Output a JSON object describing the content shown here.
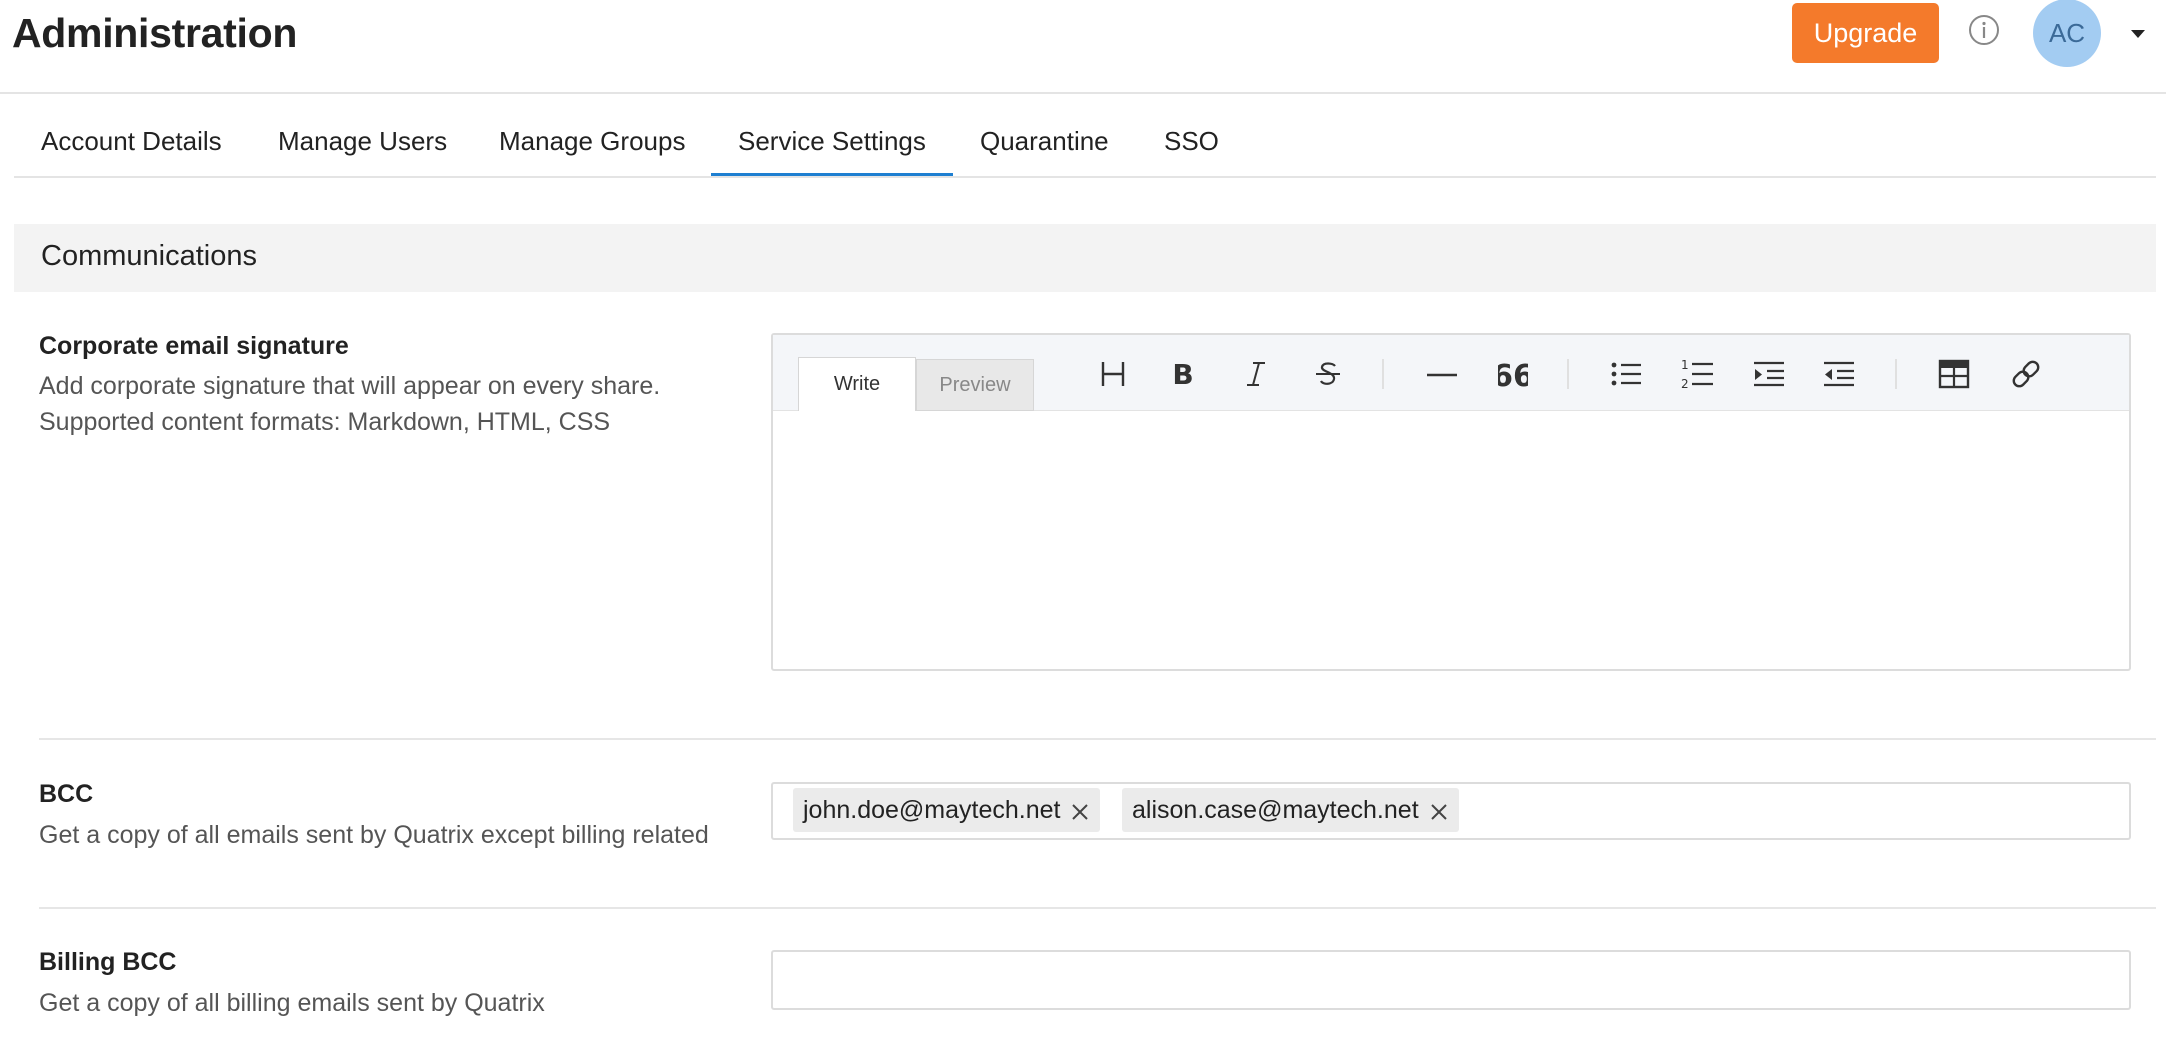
{
  "header": {
    "title": "Administration",
    "upgrade_label": "Upgrade",
    "avatar_initials": "AC",
    "info_icon": "info-icon",
    "caret_icon": "caret-down-icon",
    "accent_color": "#f47a2b"
  },
  "tabs": {
    "items": [
      {
        "label": "Account Details"
      },
      {
        "label": "Manage Users"
      },
      {
        "label": "Manage Groups"
      },
      {
        "label": "Service Settings"
      },
      {
        "label": "Quarantine"
      },
      {
        "label": "SSO"
      }
    ],
    "active": "Service Settings",
    "active_color": "#1e7fd1"
  },
  "section": {
    "title": "Communications"
  },
  "signature": {
    "label": "Corporate email signature",
    "desc_line1": "Add corporate signature that will appear on every share.",
    "desc_line2": "Supported content formats: Markdown, HTML, CSS",
    "editor_tabs": {
      "write": "Write",
      "preview": "Preview"
    },
    "toolbar_icons": [
      "heading-icon",
      "bold-icon",
      "italic-icon",
      "strikethrough-icon",
      "horizontal-rule-icon",
      "quote-icon",
      "bulleted-list-icon",
      "numbered-list-icon",
      "indent-icon",
      "outdent-icon",
      "table-icon",
      "link-icon"
    ],
    "value": ""
  },
  "bcc": {
    "label": "BCC",
    "desc": "Get a copy of all emails sent by Quatrix except billing related",
    "emails": [
      "john.doe@maytech.net",
      "alison.case@maytech.net"
    ]
  },
  "billing_bcc": {
    "label": "Billing BCC",
    "desc": "Get a copy of all billing emails sent by Quatrix",
    "value": ""
  }
}
